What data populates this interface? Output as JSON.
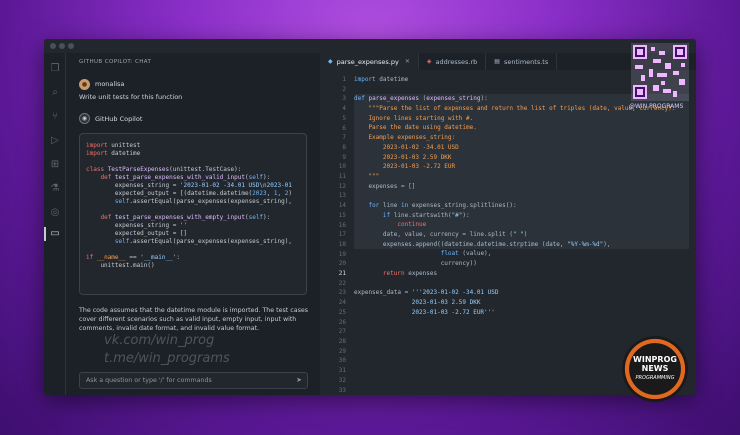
{
  "chat": {
    "header": "GITHUB COPILOT: CHAT",
    "user_name": "monalisa",
    "user_message": "Write unit tests for this function",
    "bot_name": "GitHub Copilot",
    "explanation": "The code assumes that the datetime module is imported. The test cases cover different scenarios such as valid input, empty input, input with comments, invalid date format, and invalid value format.",
    "input_placeholder": "Ask a question or type '/' for commands"
  },
  "watermarks": {
    "vk": "vk.com/win_prog",
    "tme": "t.me/win_programs",
    "qr_label": "@WIN PROGRAMS"
  },
  "badge": {
    "line1": "WINPROG",
    "line2": "NEWS",
    "line3": "PROGRAMMING"
  },
  "tabs": [
    {
      "label": "parse_expenses.py",
      "icon": "python-icon",
      "active": true
    },
    {
      "label": "addresses.rb",
      "icon": "ruby-icon",
      "active": false
    },
    {
      "label": "sentiments.ts",
      "icon": "typescript-icon",
      "active": false
    }
  ],
  "editor": {
    "line_numbers": [
      "1",
      "2",
      "3",
      "4",
      "5",
      "6",
      "7",
      "8",
      "9",
      "10",
      "11",
      "12",
      "13",
      "14",
      "15",
      "16",
      "17",
      "18",
      "19",
      "20",
      "21",
      "22",
      "23",
      "24",
      "25",
      "26",
      "27",
      "28",
      "29",
      "30",
      "31",
      "32",
      "33"
    ],
    "current_line": "21"
  }
}
